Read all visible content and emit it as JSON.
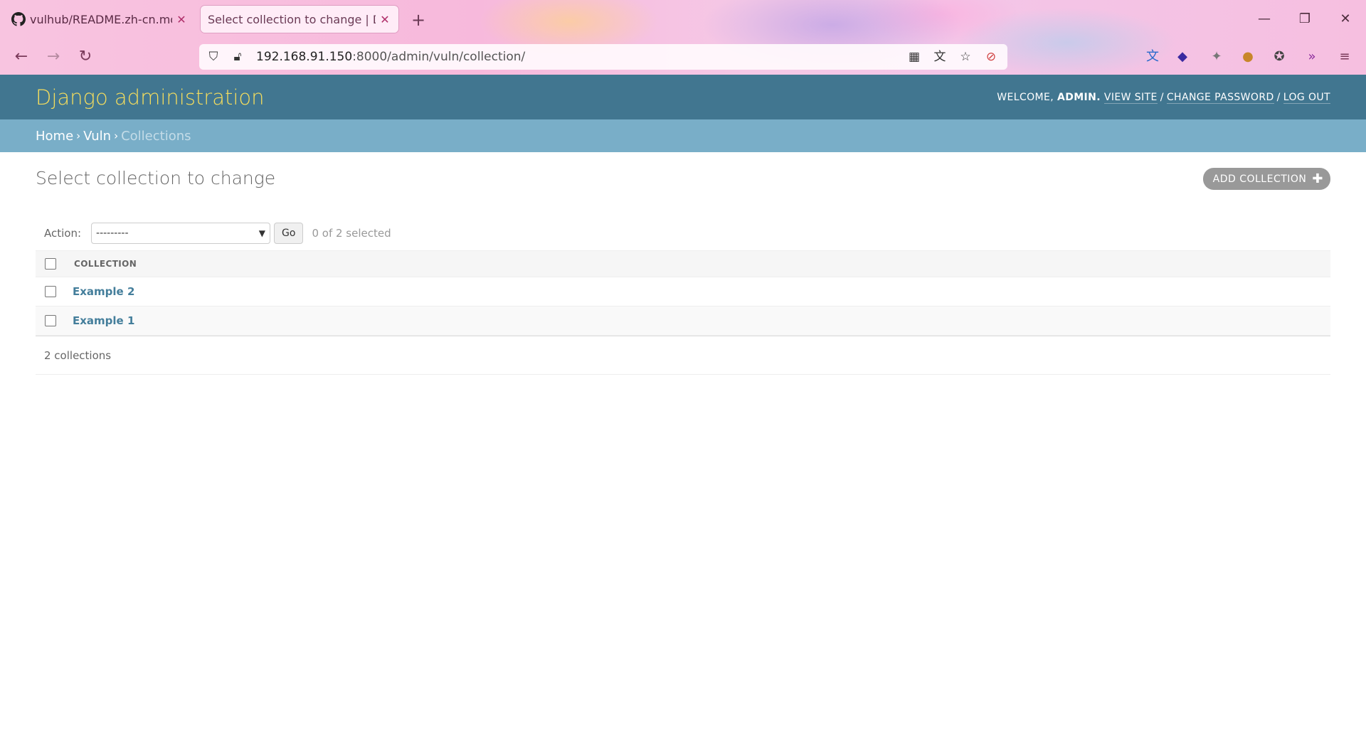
{
  "browser": {
    "tabs": [
      {
        "title": "vulhub/README.zh-cn.md at",
        "active": false
      },
      {
        "title": "Select collection to change | Dja",
        "active": true
      }
    ],
    "url_host": "192.168.91.150",
    "url_rest": ":8000/admin/vuln/collection/"
  },
  "header": {
    "branding": "Django administration",
    "welcome": "WELCOME,",
    "user": "ADMIN.",
    "view_site": "VIEW SITE",
    "change_password": "CHANGE PASSWORD",
    "log_out": "LOG OUT"
  },
  "breadcrumbs": {
    "home": "Home",
    "app": "Vuln",
    "current": "Collections"
  },
  "page": {
    "title": "Select collection to change",
    "add_button": "ADD COLLECTION"
  },
  "actions": {
    "label": "Action:",
    "selected_option": "---------",
    "go": "Go",
    "selection_count": "0 of 2 selected"
  },
  "table": {
    "column_header": "COLLECTION",
    "rows": [
      {
        "name": "Example 2"
      },
      {
        "name": "Example 1"
      }
    ],
    "footer": "2 collections"
  }
}
